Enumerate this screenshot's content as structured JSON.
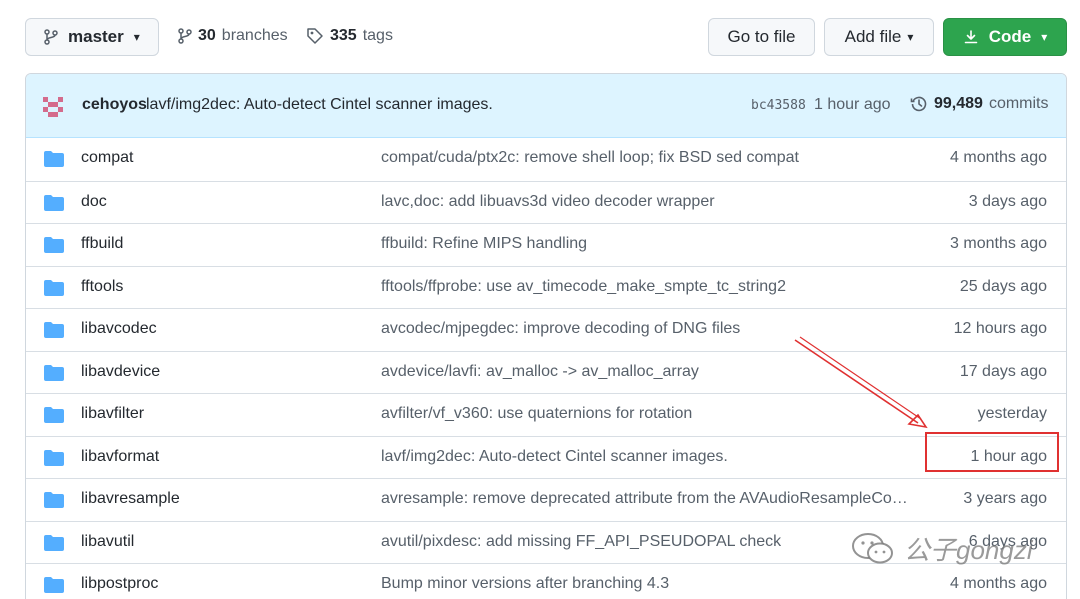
{
  "toolbar": {
    "branch_label": "master",
    "branches_count": "30",
    "branches_label": "branches",
    "tags_count": "335",
    "tags_label": "tags",
    "go_to_file_label": "Go to file",
    "add_file_label": "Add file",
    "code_label": "Code"
  },
  "latest_commit": {
    "author": "cehoyos",
    "message": "lavf/img2dec: Auto-detect Cintel scanner images.",
    "sha": "bc43588",
    "time": "1 hour ago",
    "commits_count": "99,489",
    "commits_label": "commits"
  },
  "files": [
    {
      "name": "compat",
      "message": "compat/cuda/ptx2c: remove shell loop; fix BSD sed compat",
      "age": "4 months ago"
    },
    {
      "name": "doc",
      "message": "lavc,doc: add libuavs3d video decoder wrapper",
      "age": "3 days ago"
    },
    {
      "name": "ffbuild",
      "message": "ffbuild: Refine MIPS handling",
      "age": "3 months ago"
    },
    {
      "name": "fftools",
      "message": "fftools/ffprobe: use av_timecode_make_smpte_tc_string2",
      "age": "25 days ago"
    },
    {
      "name": "libavcodec",
      "message": "avcodec/mjpegdec: improve decoding of DNG files",
      "age": "12 hours ago"
    },
    {
      "name": "libavdevice",
      "message": "avdevice/lavfi: av_malloc -> av_malloc_array",
      "age": "17 days ago"
    },
    {
      "name": "libavfilter",
      "message": "avfilter/vf_v360: use quaternions for rotation",
      "age": "yesterday"
    },
    {
      "name": "libavformat",
      "message": "lavf/img2dec: Auto-detect Cintel scanner images.",
      "age": "1 hour ago"
    },
    {
      "name": "libavresample",
      "message": "avresample: remove deprecated attribute from the AVAudioResampleCo…",
      "age": "3 years ago"
    },
    {
      "name": "libavutil",
      "message": "avutil/pixdesc: add missing FF_API_PSEUDOPAL check",
      "age": "6 days ago"
    },
    {
      "name": "libpostproc",
      "message": "Bump minor versions after branching 4.3",
      "age": "4 months ago"
    }
  ],
  "watermark": {
    "text": "公子gongzi"
  },
  "colors": {
    "accent_green": "#2da44e",
    "folder_blue": "#54aeff",
    "commit_bar_bg": "#ddf4ff",
    "annotation_red": "#e03131"
  }
}
